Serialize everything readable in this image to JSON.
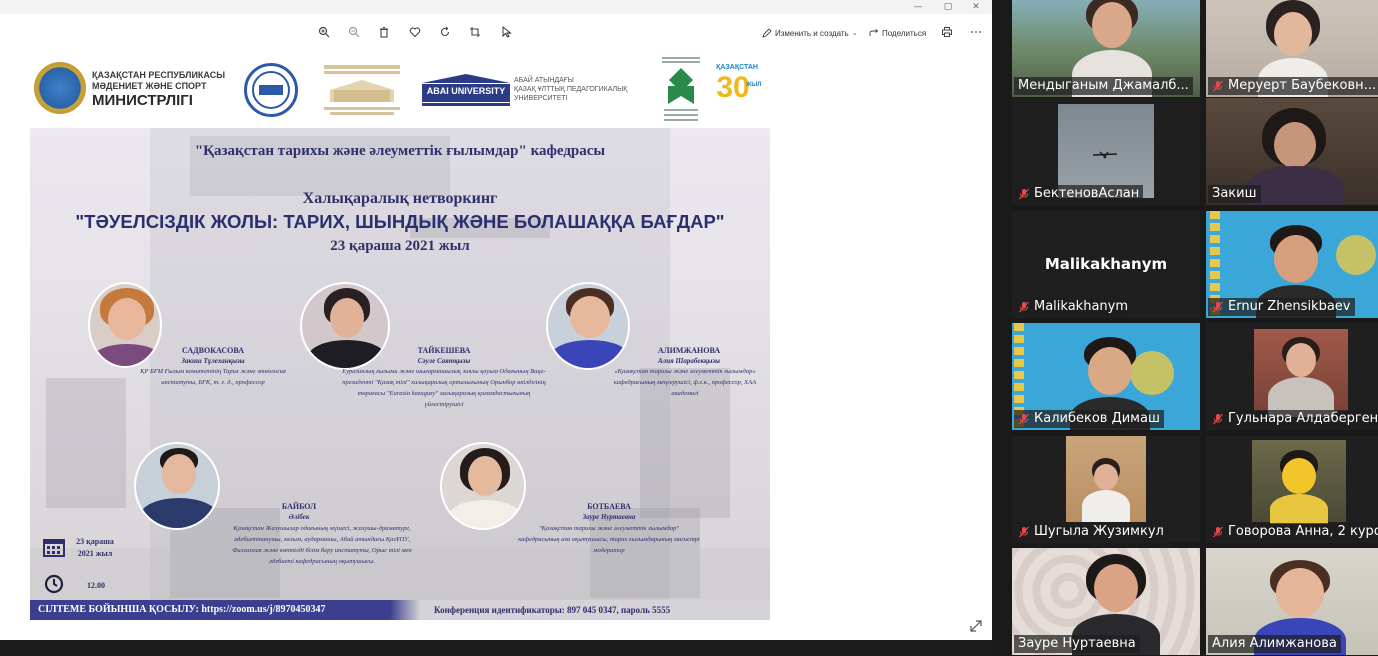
{
  "toolbar": {
    "edit_label": "Изменить и создать",
    "share_label": "Поделиться"
  },
  "poster": {
    "logos": {
      "ministry_line1": "ҚАЗАҚСТАН РЕСПУБЛИКАСЫ",
      "ministry_line2": "МӘДЕНИЕТ ЖӘНЕ СПОРТ",
      "ministry_line3": "МИНИСТРЛІГІ",
      "univ_name": "ABAI UNIVERSITY",
      "univ_line1": "АБАЙ АТЫНДАҒЫ",
      "univ_line2": "ҚАЗАҚ ҰЛТТЫҚ ПЕДАГОГИКАЛЫҚ",
      "univ_line3": "УНИВЕРСИТЕТІ",
      "kz30_line1": "ҚАЗАҚСТАН",
      "kz30_num": "30",
      "kz30_line2": "ЖЫЛ"
    },
    "department": "\"Қазақстан тарихы және әлеуметтік ғылымдар\" кафедрасы",
    "event_type": "Халықаралық нетворкинг",
    "event_title": "\"ТӘУЕЛСІЗДІК ЖОЛЫ: ТАРИХ, ШЫНДЫҚ ЖӘНЕ БОЛАШАҚҚА БАҒДАР\"",
    "event_date": "23 қараша 2021 жыл",
    "speakers": [
      {
        "name": "САДВОКАСОВА",
        "first": "Закиш Тұлеханқызы",
        "desc": "ҚР БҒМ Ғылым комитетінің Тарих және этнология институты, БҒК, т. ғ. д., профессор"
      },
      {
        "name": "ТАЙКЕШЕВА",
        "first": "Сәуле Саятқызы",
        "desc": "Еуразиялық ғылыми және шығармашылық зиялы қауым Одағының Вице-президенті \"Қазақ тілі\" халықаралық орталығының Орынбор өкілдігінің төрағасы \"Eurasia kazaguzy\" халықаралық қоғамдастығының үйлестірушісі"
      },
      {
        "name": "АЛИМЖАНОВА",
        "first": "Алия Шарабекқызы",
        "desc": "«Қазақстан тарихы және әлеуметтік ғылымдар» кафедрасының меңгерушісі, ф.ғ.к., профессор, ХАА академигі"
      },
      {
        "name": "БАЙБОЛ",
        "first": "Әлібек",
        "desc": "Қазақстан Жазушылар одағының мүшесі, жазушы-драматург, әдебиеттанушы, ғалым, аудармашы, Абай атындағы ҚазҰПУ, Филология және көптілді білім беру институты, Орыс тілі мен әдебиеті кафедрасының оқытушысы."
      },
      {
        "name": "БОТБАЕВА",
        "first": "Зауре Нуртаевна",
        "desc": "\"Қазақстан тарихы және әлеуметтік ғылымдар\" кафедрасының аға оқытушысы, тарих ғылымдарының магистрі модератор"
      }
    ],
    "date_block_line1": "23 қараша",
    "date_block_line2": "2021 жыл",
    "time": "12.00",
    "footer_link": "СІЛТЕМЕ БОЙЫНША ҚОСЫЛУ:  https://zoom.us/j/8970450347",
    "footer_conf": "Конференция идентификаторы: 897 045 0347, пароль 5555"
  },
  "participants": [
    {
      "name": "Мендыганым Джамалб...",
      "muted": false
    },
    {
      "name": "Меруерт Баубековн...",
      "muted": true
    },
    {
      "name": "БектеновАслан",
      "muted": true
    },
    {
      "name": "Закиш",
      "muted": false
    },
    {
      "name": "Malikakhanym",
      "muted": true,
      "display": "Malikakhanym"
    },
    {
      "name": "Ernur Zhensikbaev",
      "muted": true
    },
    {
      "name": "Калибеков Димаш",
      "muted": true
    },
    {
      "name": "Гульнара Алдабергенова",
      "muted": true
    },
    {
      "name": "Шугыла Жузимкул",
      "muted": true
    },
    {
      "name": "Говорова Анна, 2 курс",
      "muted": true
    },
    {
      "name": "Зауре Нуртаевна",
      "muted": false
    },
    {
      "name": "Алия Алимжанова",
      "muted": false
    }
  ],
  "colors": {
    "poster_text": "#2e2f6b",
    "footer_bar": "#3c3f8f",
    "active_speaker": "#c6e35d",
    "muted_icon": "#e5484d"
  }
}
